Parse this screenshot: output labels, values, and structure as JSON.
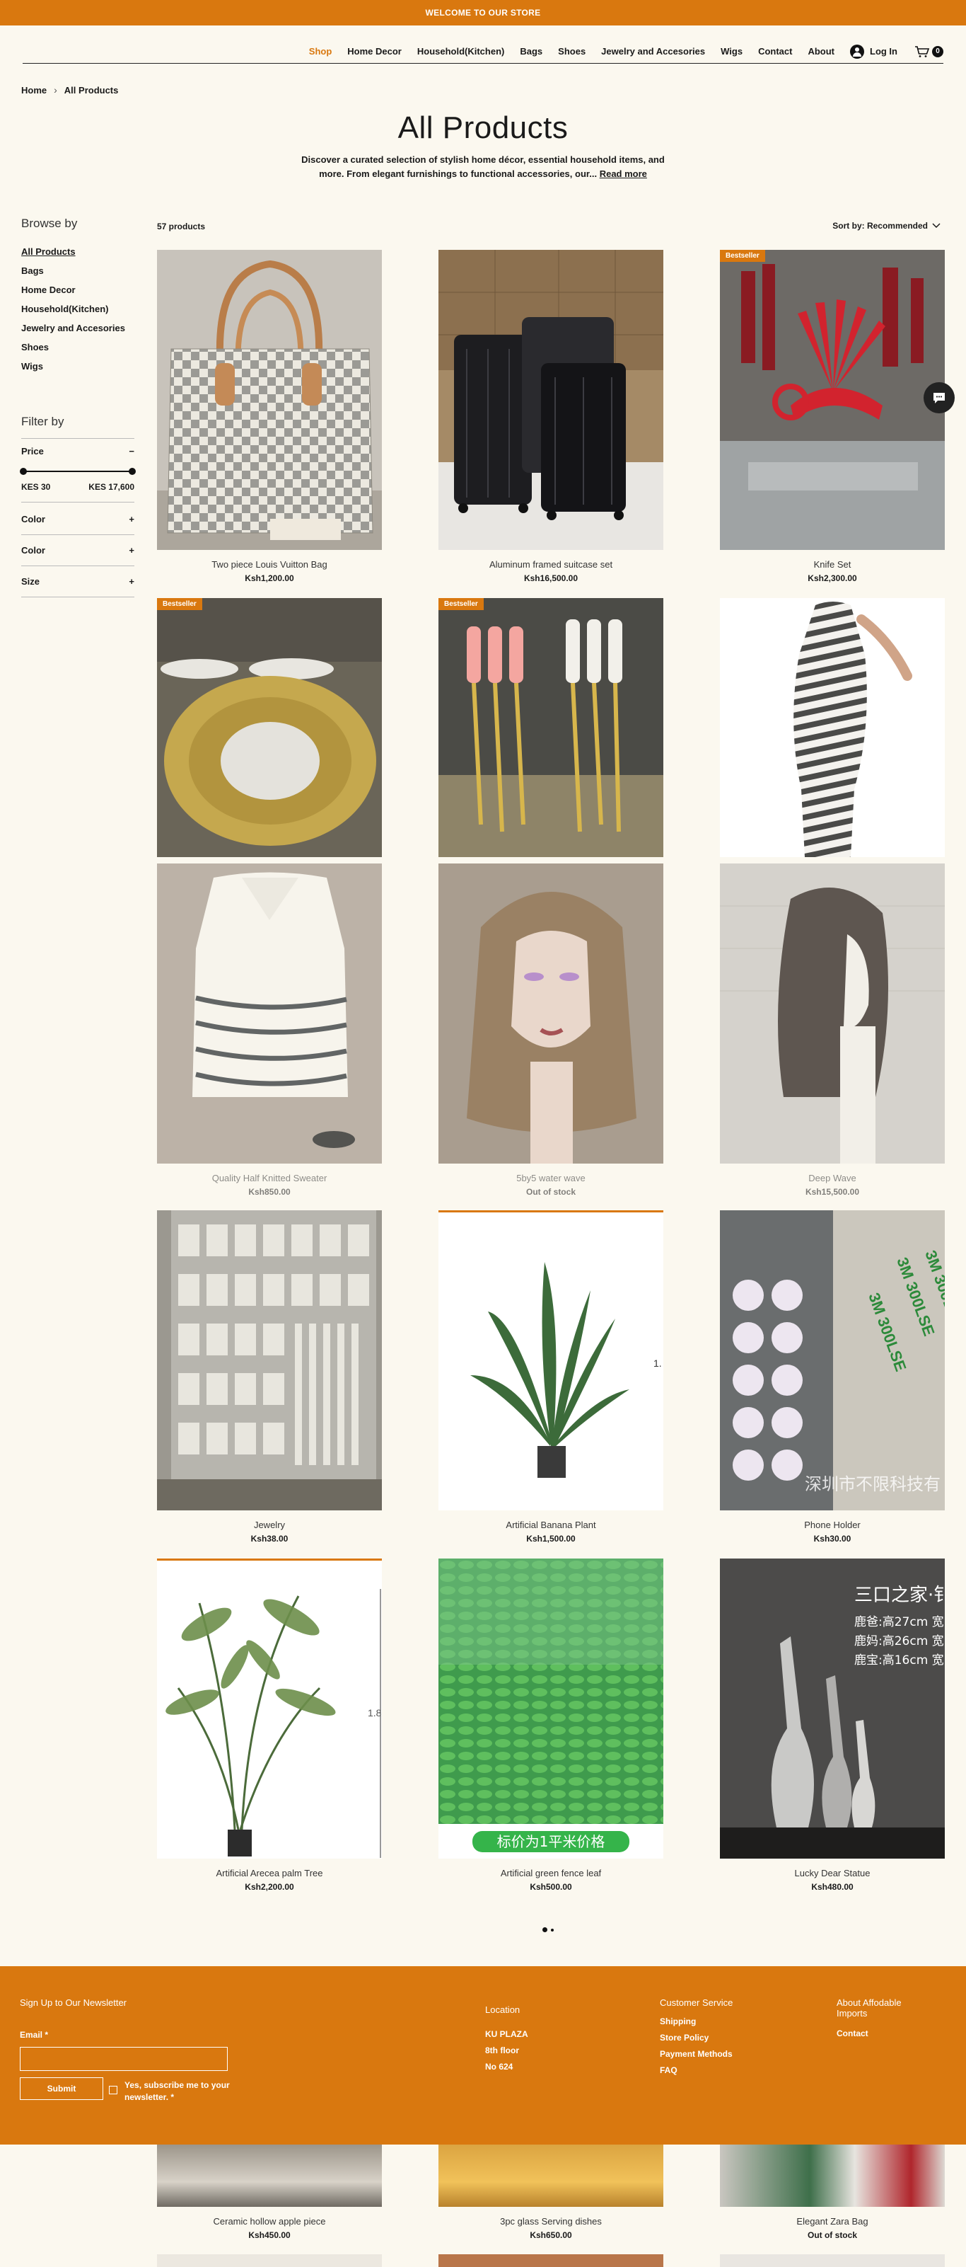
{
  "banner": "WELCOME TO OUR STORE",
  "nav": {
    "items": [
      "Shop",
      "Home Decor",
      "Household(Kitchen)",
      "Bags",
      "Shoes",
      "Jewelry and Accesories",
      "Wigs",
      "Contact",
      "About"
    ],
    "login": "Log In",
    "cart_count": "0"
  },
  "breadcrumb": {
    "home": "Home",
    "current": "All Products"
  },
  "page": {
    "title": "All Products",
    "intro": "Discover a curated selection of stylish home décor, essential household items, and more. From elegant furnishings to functional accessories, our...",
    "read_more": "Read more"
  },
  "sidebar": {
    "browse_title": "Browse by",
    "categories": [
      "All Products",
      "Bags",
      "Home Decor",
      "Household(Kitchen)",
      "Jewelry and Accesories",
      "Shoes",
      "Wigs"
    ],
    "filter_title": "Filter by",
    "price_label": "Price",
    "price_min": "KES 30",
    "price_max": "KES 17,600",
    "filters": [
      "Color",
      "Color",
      "Size"
    ]
  },
  "listing": {
    "count": "57 products",
    "sort": "Sort by: Recommended"
  },
  "products": [
    {
      "name": "Two piece Louis Vuitton Bag",
      "price": "Ksh1,200.00"
    },
    {
      "name": "Aluminum framed suitcase set",
      "price": "Ksh16,500.00"
    },
    {
      "name": "Knife Set",
      "price": "Ksh2,300.00",
      "badge": "Bestseller"
    },
    {
      "name": "",
      "price": "",
      "badge": "Bestseller"
    },
    {
      "name": "",
      "price": "",
      "badge": "Bestseller"
    },
    {
      "name": "",
      "price": ""
    },
    {
      "name": "Quality Half Knitted Sweater",
      "price": "Ksh850.00"
    },
    {
      "name": "5by5 water wave",
      "price": "Out of stock"
    },
    {
      "name": "Deep Wave",
      "price": "Ksh15,500.00"
    },
    {
      "name": "Jewelry",
      "price": "Ksh38.00"
    },
    {
      "name": "Artificial Banana Plant",
      "price": "Ksh1,500.00"
    },
    {
      "name": "Phone Holder",
      "price": "Ksh30.00"
    },
    {
      "name": "Artificial Arecea palm Tree",
      "price": "Ksh2,200.00"
    },
    {
      "name": "Artificial green fence leaf",
      "price": "Ksh500.00"
    },
    {
      "name": "Lucky Dear Statue",
      "price": "Ksh480.00"
    }
  ],
  "image_text": {
    "plant_edge": "1.",
    "palm_edge": "1.8",
    "fence_label": "标价为1平米价格",
    "statue_title": "三口之家·钅",
    "statue_lines": [
      "鹿爸:高27cm 宽",
      "鹿妈:高26cm 宽",
      "鹿宝:高16cm 宽"
    ],
    "phone_text": "深圳市不限科技有",
    "phone_tape": [
      "3M 300LSE",
      "3M 300LSE",
      "3M 300LSE"
    ]
  },
  "footer": {
    "newsletter_title": "Sign Up to Our Newsletter",
    "email_label": "Email *",
    "submit": "Submit",
    "subscribe": "Yes, subscribe me to your newsletter. *",
    "location_title": "Location",
    "location": [
      "KU PLAZA",
      "8th floor",
      "No 624"
    ],
    "service_title": "Customer Service",
    "service_links": [
      "Shipping",
      "Store Policy",
      "Payment Methods",
      "FAQ"
    ],
    "about_title": "About Affodable Imports",
    "about_links": [
      "Contact"
    ]
  },
  "lower_products": [
    {
      "name": "Ceramic hollow apple piece",
      "price": "Ksh450.00"
    },
    {
      "name": "3pc glass Serving dishes",
      "price": "Ksh650.00"
    },
    {
      "name": "Elegant Zara Bag",
      "price": "Out of stock"
    }
  ],
  "colors": {
    "accent": "#d9780f",
    "background": "#fbf8ef",
    "text": "#1a1a1a"
  }
}
